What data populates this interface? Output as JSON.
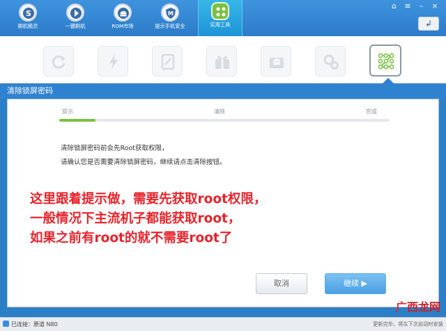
{
  "nav": {
    "items": [
      {
        "label": "刷机精灵",
        "icon": "s-logo-icon"
      },
      {
        "label": "一键刷机",
        "icon": "lightning-icon"
      },
      {
        "label": "ROM市场",
        "icon": "android-icon"
      },
      {
        "label": "提示手机安全",
        "icon": "shield-m-icon"
      },
      {
        "label": "实用工具",
        "icon": "grid-tools-icon"
      }
    ],
    "active_index": 4
  },
  "window": {
    "back_symbol": "↲"
  },
  "toolbar": {
    "tools": [
      "refresh-icon",
      "lightning-icon",
      "edit-icon",
      "gift-icon",
      "android-box-icon",
      "gears-icon",
      "pattern-lock-icon"
    ],
    "active_index": 6
  },
  "section": {
    "title": "清除锁屏密码"
  },
  "steps": {
    "labels": [
      "提示",
      "清除",
      "完成"
    ],
    "progress": 0.11
  },
  "messages": {
    "line1": "清除锁屏密码前会先Root获取权限，",
    "line2": "请确认您是否需要清除锁屏密码，继续请点击清除按钮。"
  },
  "annotation": {
    "line1": "这里跟着提示做，需要先获取root权限，",
    "line2": "一般情况下主流机子都能获取root，",
    "line3": "如果之前有root的就不需要root了"
  },
  "buttons": {
    "cancel": "取消",
    "continue": "继续 ▶"
  },
  "status": {
    "connected": "已连接：原道 N80",
    "right": "更新完毕，将在下次启动时安装"
  },
  "watermark": {
    "text": "广西龙网",
    "symbol": "广"
  },
  "colors": {
    "accent": "#2f82cf",
    "progress": "#7bc043",
    "annotation": "#e6232b"
  }
}
